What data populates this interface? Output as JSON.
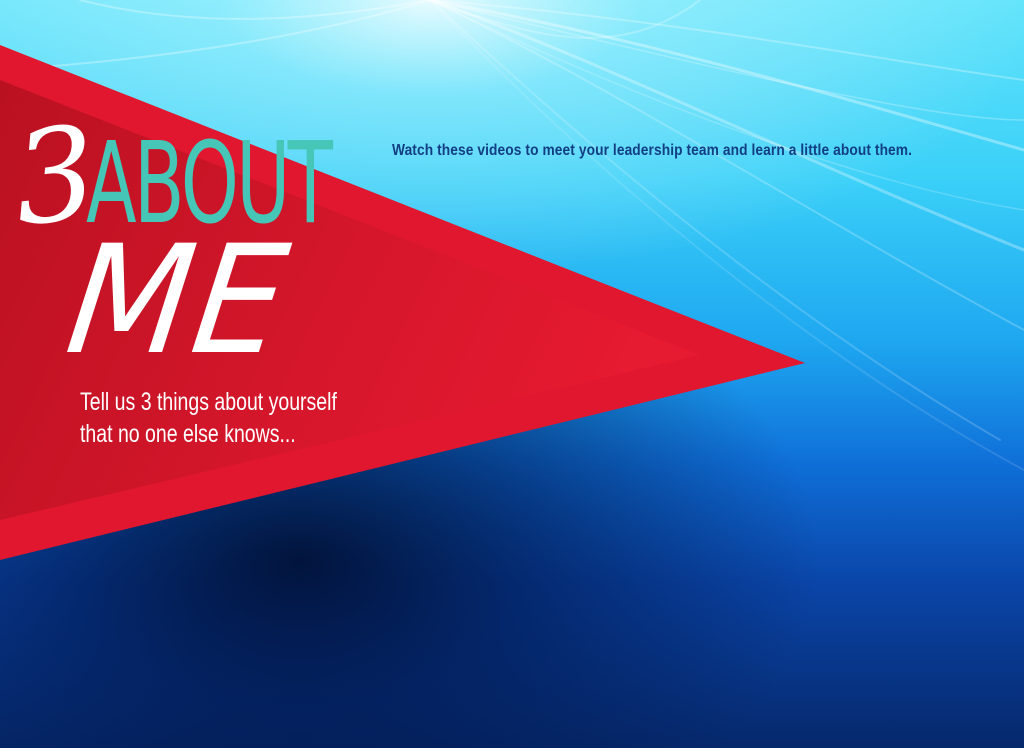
{
  "headline": {
    "number": "3",
    "about": "ABOUT",
    "me": "ME"
  },
  "intro": {
    "watch_text": "Watch these videos to meet your leadership team and learn a little about them."
  },
  "prompt": {
    "line1": "Tell us 3 things about yourself",
    "line2": "that no one else knows..."
  },
  "colors": {
    "pennant_red": "#e0172f",
    "about_teal": "#45c6b6",
    "watch_text_navy": "#123f84",
    "sky_light": "#62e4fb",
    "sky_deep": "#06286b"
  }
}
